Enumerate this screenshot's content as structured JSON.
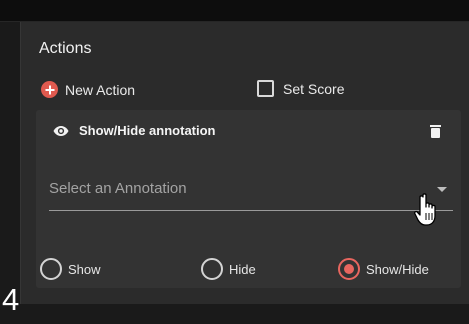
{
  "panel": {
    "title": "Actions",
    "new_action_label": "New Action",
    "set_score_label": "Set Score",
    "set_score_checked": false
  },
  "action_card": {
    "icon": "eye-icon",
    "title": "Show/Hide annotation",
    "delete_icon": "trash-icon",
    "select": {
      "value": "Select an Annotation",
      "icon": "dropdown-arrow-icon"
    },
    "visibility_options": [
      {
        "label": "Show",
        "selected": false
      },
      {
        "label": "Hide",
        "selected": false
      },
      {
        "label": "Show/Hide",
        "selected": true
      }
    ]
  },
  "step_label": "4",
  "colors": {
    "accent": "#e8665f",
    "panel_bg": "#2b2b2b",
    "card_bg": "#333333"
  }
}
